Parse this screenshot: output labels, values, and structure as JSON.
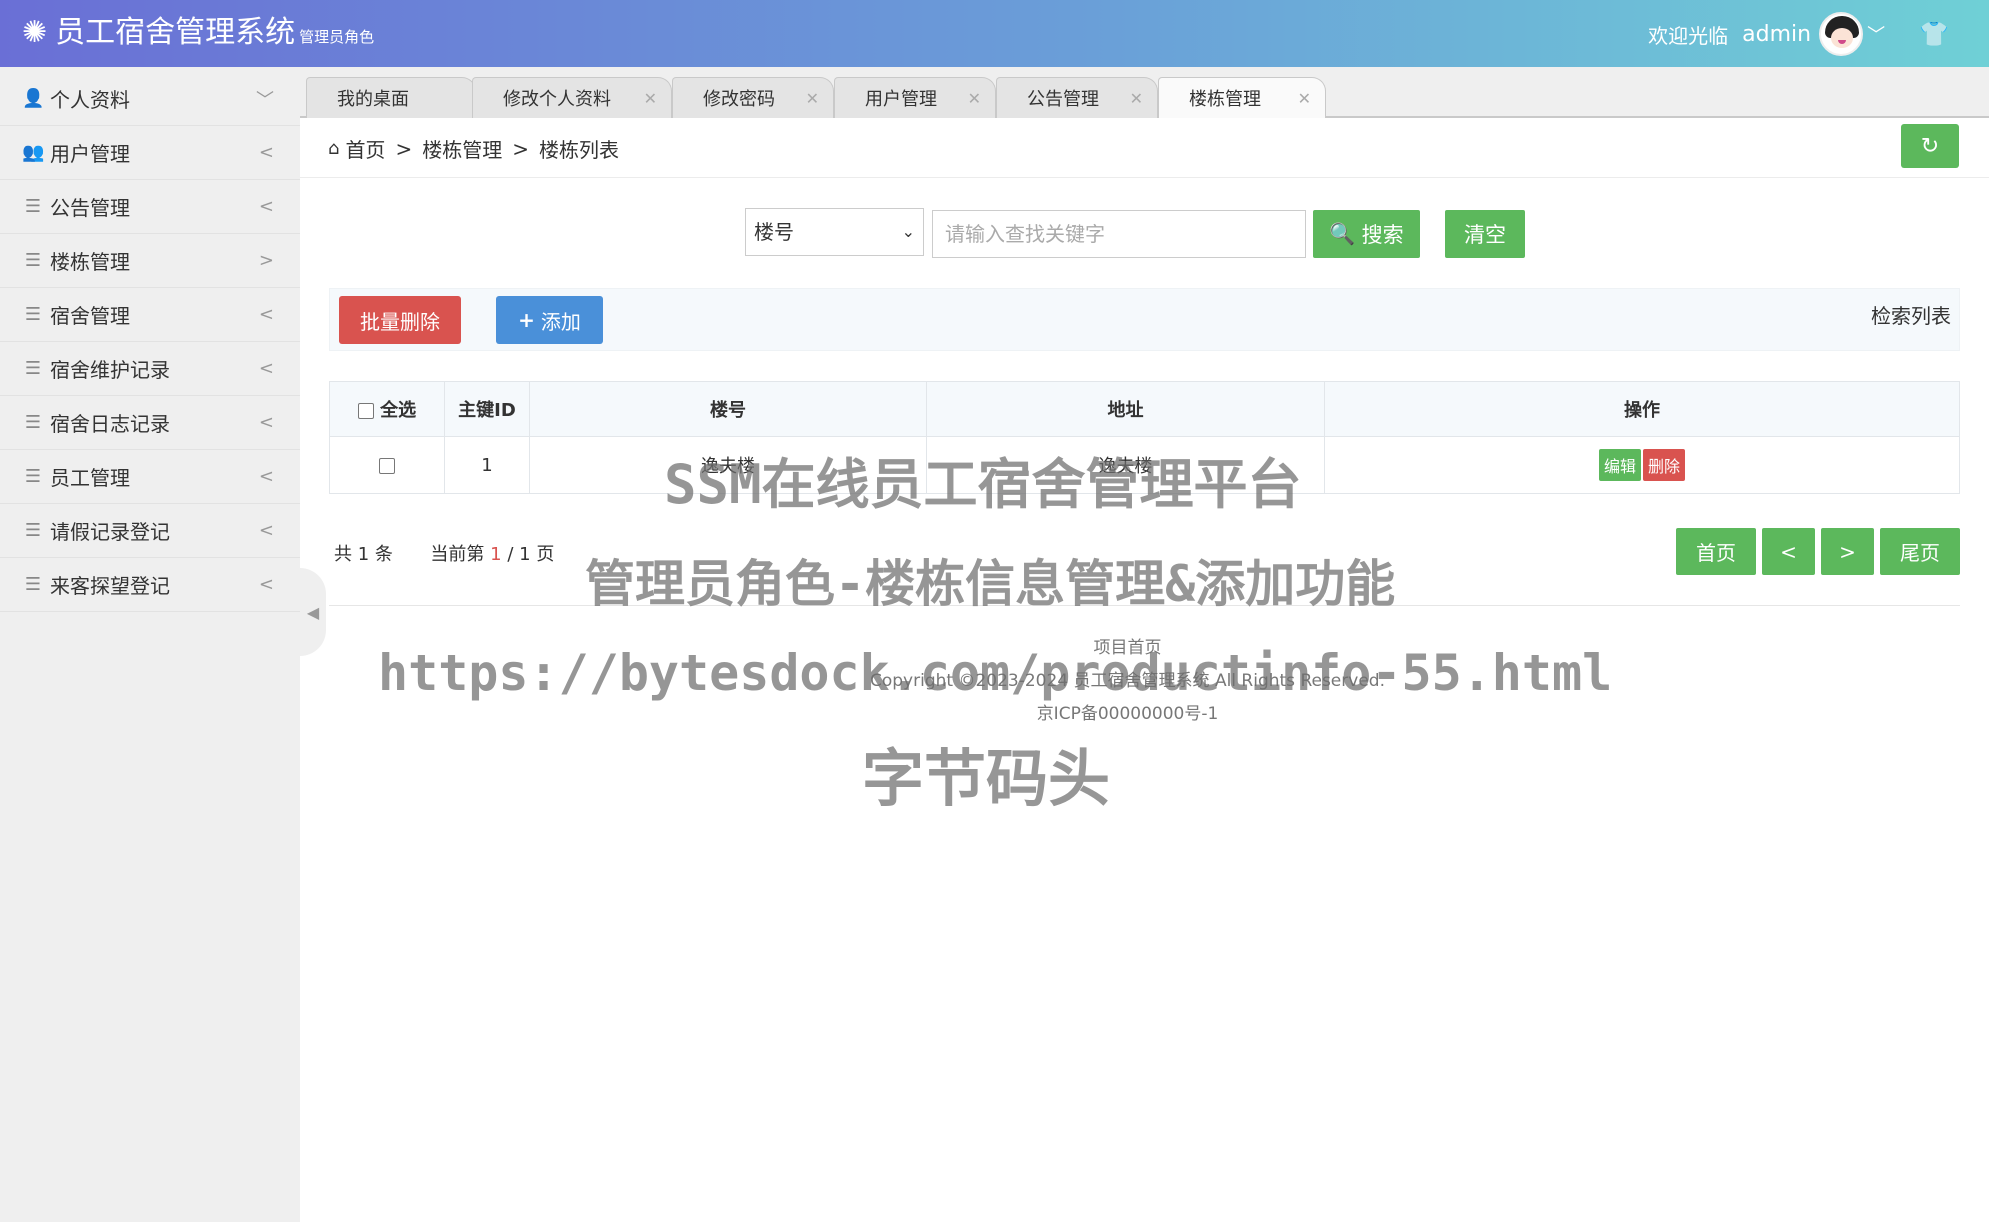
{
  "header": {
    "title": "员工宿舍管理系统",
    "role": "管理员角色",
    "welcome": "欢迎光临",
    "username": "admin",
    "icons": {
      "logo": "gear-icon",
      "caret": "chevron-down-icon",
      "skin": "shirt-icon"
    },
    "colors": {
      "start": "#6a6fd6",
      "end": "#6fd0d6"
    }
  },
  "sidebar": {
    "items": [
      {
        "label": "个人资料",
        "icon": "user-icon",
        "arrow": "﹀"
      },
      {
        "label": "用户管理",
        "icon": "users-icon",
        "arrow": "<"
      },
      {
        "label": "公告管理",
        "icon": "menu-icon",
        "arrow": "<"
      },
      {
        "label": "楼栋管理",
        "icon": "menu-icon",
        "arrow": ">"
      },
      {
        "label": "宿舍管理",
        "icon": "menu-icon",
        "arrow": "<"
      },
      {
        "label": "宿舍维护记录",
        "icon": "menu-icon",
        "arrow": "<"
      },
      {
        "label": "宿舍日志记录",
        "icon": "menu-icon",
        "arrow": "<"
      },
      {
        "label": "员工管理",
        "icon": "menu-icon",
        "arrow": "<"
      },
      {
        "label": "请假记录登记",
        "icon": "menu-icon",
        "arrow": "<"
      },
      {
        "label": "来客探望登记",
        "icon": "menu-icon",
        "arrow": "<"
      }
    ]
  },
  "tabs": [
    {
      "label": "我的桌面",
      "closable": false
    },
    {
      "label": "修改个人资料",
      "closable": true
    },
    {
      "label": "修改密码",
      "closable": true
    },
    {
      "label": "用户管理",
      "closable": true
    },
    {
      "label": "公告管理",
      "closable": true
    },
    {
      "label": "楼栋管理",
      "closable": true,
      "active": true
    }
  ],
  "breadcrumb": {
    "home": "首页",
    "sep": ">",
    "level1": "楼栋管理",
    "level2": "楼栋列表"
  },
  "search": {
    "field_selected": "楼号",
    "placeholder": "请输入查找关键字",
    "search_label": "搜索",
    "clear_label": "清空"
  },
  "toolbar": {
    "batch_delete": "批量删除",
    "add": "添加",
    "list_label": "检索列表"
  },
  "table": {
    "headers": {
      "select_all": "全选",
      "id": "主键ID",
      "building_no": "楼号",
      "address": "地址",
      "actions": "操作"
    },
    "rows": [
      {
        "id": "1",
        "building_no": "逸夫楼",
        "address": "逸夫楼",
        "edit": "编辑",
        "delete": "删除"
      }
    ]
  },
  "pagination": {
    "total_prefix": "共",
    "total": "1",
    "total_suffix": "条",
    "current_prefix": "当前第",
    "current": "1",
    "slash": "/",
    "pages": "1",
    "pages_suffix": "页",
    "first": "首页",
    "prev": "<",
    "next": ">",
    "last": "尾页"
  },
  "footer": {
    "home_link": "项目首页",
    "copyright": "Copyright ©2023-2024 员工宿舍管理系统 All Rights Reserved.",
    "icp": "京ICP备00000000号-1"
  },
  "watermark": {
    "line1": "SSM在线员工宿舍管理平台",
    "line2": "管理员角色-楼栋信息管理&添加功能",
    "line3": "https://bytesdock.com/productinfo-55.html",
    "line4": "字节码头"
  },
  "colors": {
    "green": "#5cb85c",
    "red": "#d9534f",
    "blue": "#4a90d9"
  }
}
